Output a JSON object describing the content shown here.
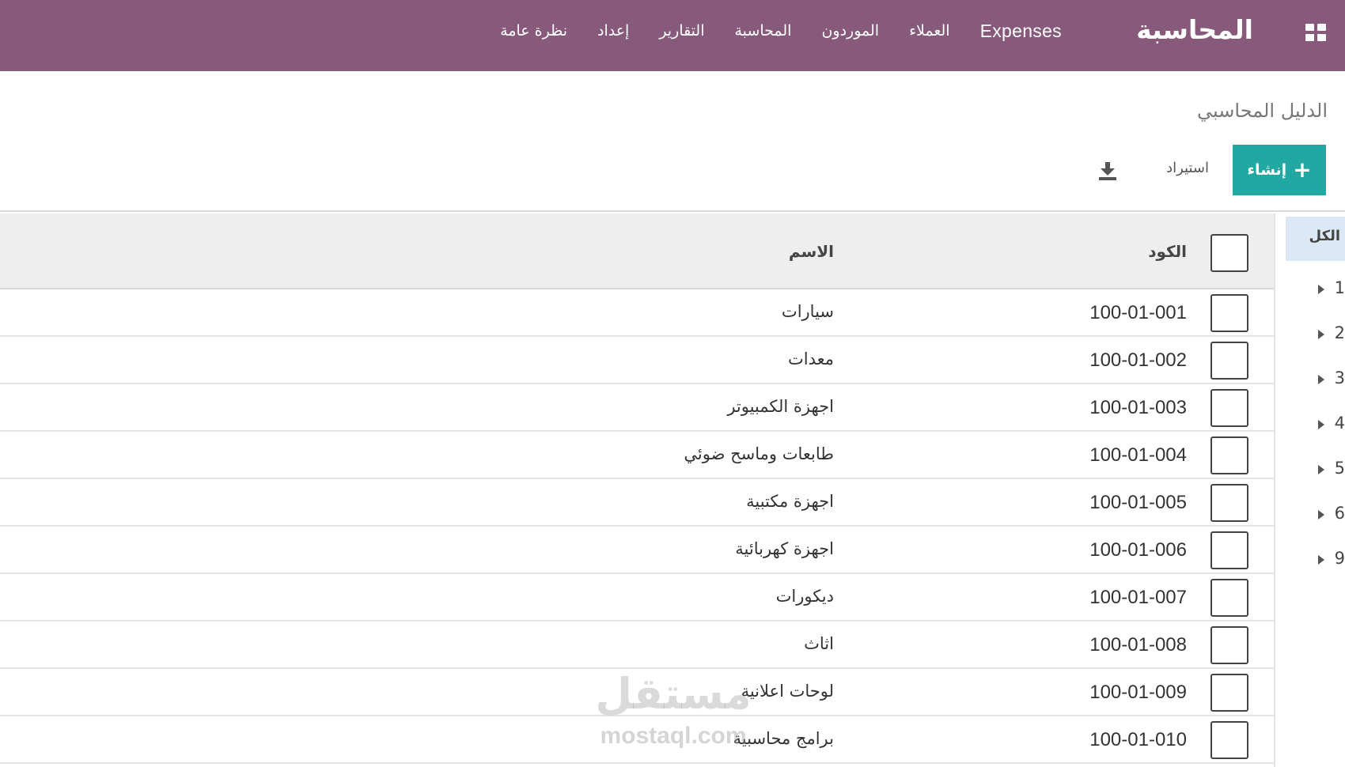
{
  "topbar": {
    "brand": "المحاسبة",
    "menu": [
      "Expenses",
      "العملاء",
      "الموردون",
      "المحاسبة",
      "التقارير",
      "إعداد",
      "نظرة عامة"
    ]
  },
  "control_panel": {
    "breadcrumb": "الدليل المحاسبي",
    "create_label": "إنشاء",
    "import_label": "استيراد"
  },
  "side_panel": {
    "all_label": "الكل",
    "items": [
      "1",
      "2",
      "3",
      "4",
      "5",
      "6",
      "9"
    ]
  },
  "table": {
    "headers": {
      "code": "الكود",
      "name": "الاسم"
    },
    "rows": [
      {
        "code": "100-01-001",
        "name": "سيارات"
      },
      {
        "code": "100-01-002",
        "name": "معدات"
      },
      {
        "code": "100-01-003",
        "name": "اجهزة الكمبيوتر"
      },
      {
        "code": "100-01-004",
        "name": "طابعات وماسح ضوئي"
      },
      {
        "code": "100-01-005",
        "name": "اجهزة مكتبية"
      },
      {
        "code": "100-01-006",
        "name": "اجهزة كهربائية"
      },
      {
        "code": "100-01-007",
        "name": "ديكورات"
      },
      {
        "code": "100-01-008",
        "name": "اثاث"
      },
      {
        "code": "100-01-009",
        "name": "لوحات اعلانية"
      },
      {
        "code": "100-01-010",
        "name": "برامج محاسبية"
      }
    ]
  },
  "watermark": {
    "ar": "مستقل",
    "en": "mostaql.com"
  }
}
